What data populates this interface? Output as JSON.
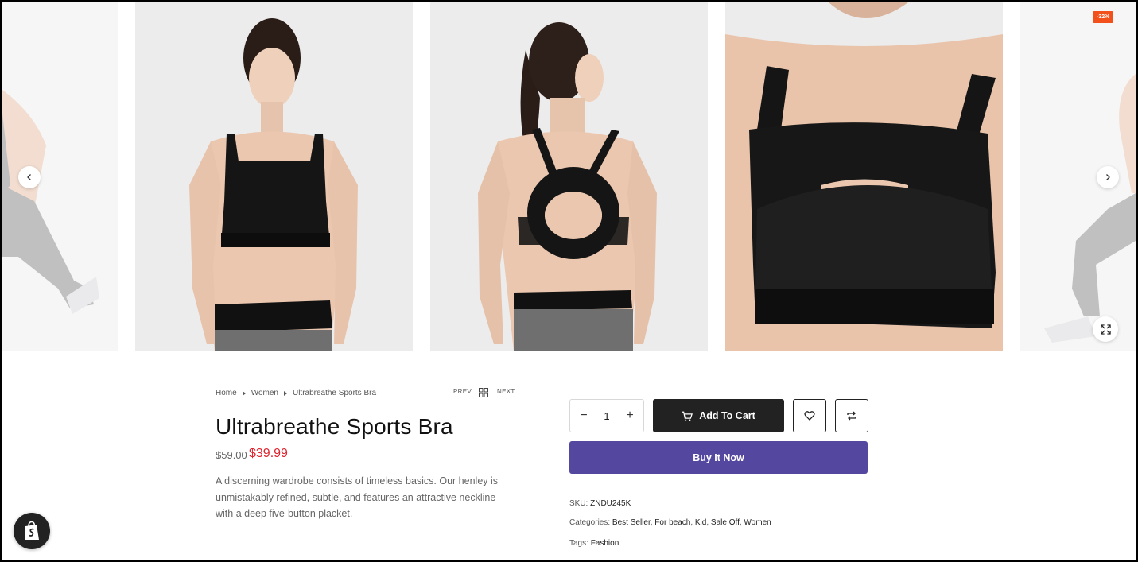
{
  "gallery": {
    "badge": "-32%",
    "images": [
      "product-image-1",
      "product-image-2",
      "product-image-3",
      "product-image-4",
      "product-image-5"
    ]
  },
  "breadcrumb": {
    "home": "Home",
    "category": "Women",
    "current": "Ultrabreathe Sports Bra"
  },
  "pager": {
    "prev": "PREV",
    "next": "NEXT"
  },
  "product": {
    "title": "Ultrabreathe Sports Bra",
    "old_price": "$59.00",
    "new_price": "$39.99",
    "description": "A discerning wardrobe consists of timeless basics. Our henley is unmistakably refined, subtle, and features an attractive neckline with a deep five-button placket."
  },
  "purchase": {
    "quantity": "1",
    "minus": "−",
    "plus": "+",
    "add_to_cart": "Add To Cart",
    "buy_now": "Buy It Now"
  },
  "meta": {
    "sku_label": "SKU:",
    "sku_value": "ZNDU245K",
    "categories_label": "Categories:",
    "categories": [
      "Best Seller",
      "For beach",
      "Kid",
      "Sale Off",
      "Women"
    ],
    "tags_label": "Tags:",
    "tags": [
      "Fashion"
    ]
  },
  "colors": {
    "sale_price": "#e0242e",
    "buy_now": "#5447a0",
    "badge": "#f2511b",
    "cart_button": "#222222"
  }
}
